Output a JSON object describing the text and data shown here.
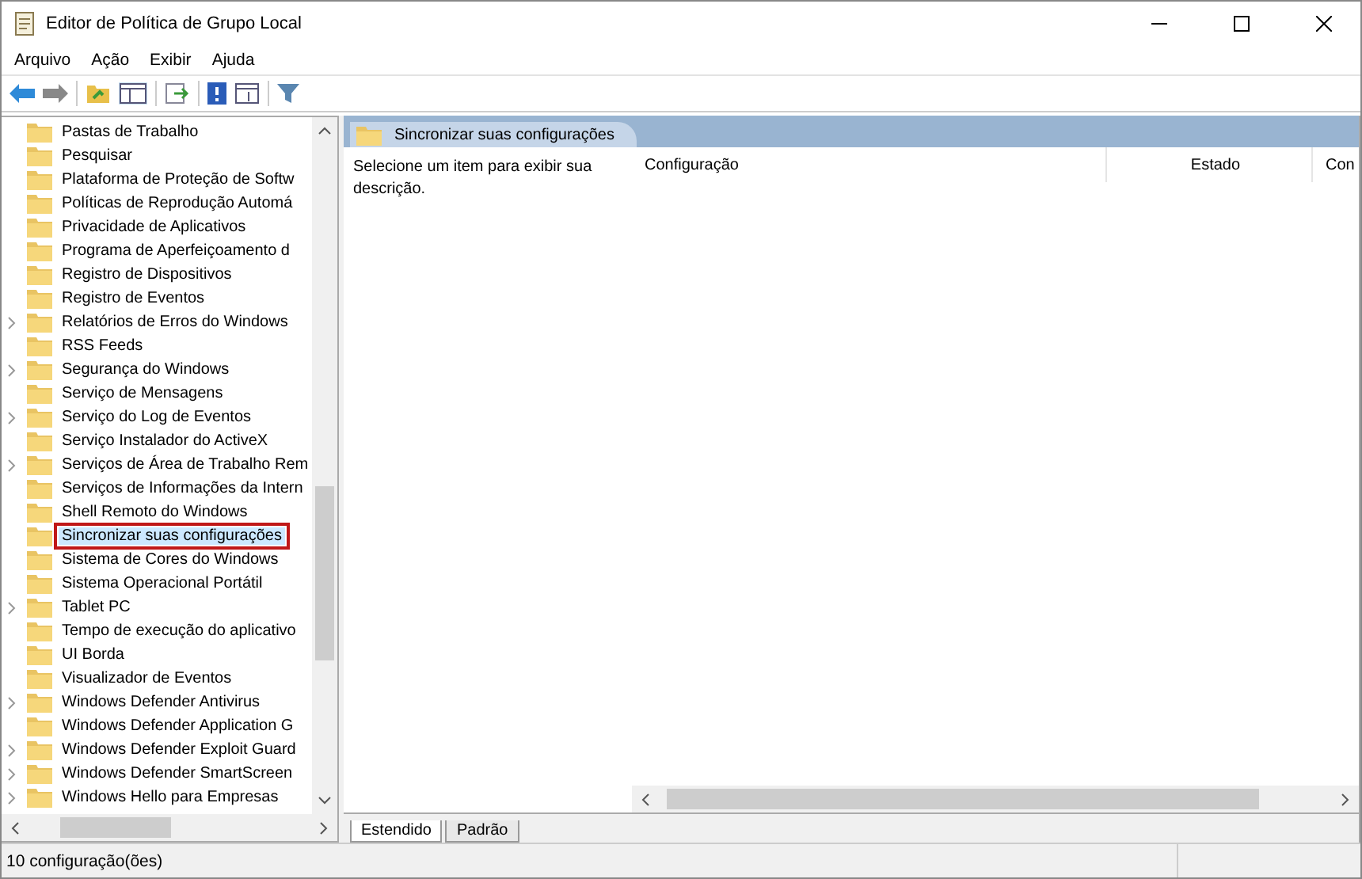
{
  "window": {
    "title": "Editor de Política de Grupo Local"
  },
  "menu": [
    "Arquivo",
    "Ação",
    "Exibir",
    "Ajuda"
  ],
  "tree": {
    "items": [
      {
        "label": "Pastas de Trabalho",
        "expandable": false,
        "selected": false
      },
      {
        "label": "Pesquisar",
        "expandable": false,
        "selected": false
      },
      {
        "label": "Plataforma de Proteção de Softw",
        "expandable": false,
        "selected": false
      },
      {
        "label": "Políticas de Reprodução Automá",
        "expandable": false,
        "selected": false
      },
      {
        "label": "Privacidade de Aplicativos",
        "expandable": false,
        "selected": false
      },
      {
        "label": "Programa de Aperfeiçoamento d",
        "expandable": false,
        "selected": false
      },
      {
        "label": "Registro de Dispositivos",
        "expandable": false,
        "selected": false
      },
      {
        "label": "Registro de Eventos",
        "expandable": false,
        "selected": false
      },
      {
        "label": "Relatórios de Erros do Windows",
        "expandable": true,
        "selected": false
      },
      {
        "label": "RSS Feeds",
        "expandable": false,
        "selected": false
      },
      {
        "label": "Segurança do Windows",
        "expandable": true,
        "selected": false
      },
      {
        "label": "Serviço de Mensagens",
        "expandable": false,
        "selected": false
      },
      {
        "label": "Serviço do Log de Eventos",
        "expandable": true,
        "selected": false
      },
      {
        "label": "Serviço Instalador do ActiveX",
        "expandable": false,
        "selected": false
      },
      {
        "label": "Serviços de Área de Trabalho Rem",
        "expandable": true,
        "selected": false
      },
      {
        "label": "Serviços de Informações da Intern",
        "expandable": false,
        "selected": false
      },
      {
        "label": "Shell Remoto do Windows",
        "expandable": false,
        "selected": false
      },
      {
        "label": "Sincronizar suas configurações",
        "expandable": false,
        "selected": true
      },
      {
        "label": "Sistema de Cores do Windows",
        "expandable": false,
        "selected": false
      },
      {
        "label": "Sistema Operacional Portátil",
        "expandable": false,
        "selected": false
      },
      {
        "label": "Tablet PC",
        "expandable": true,
        "selected": false
      },
      {
        "label": "Tempo de execução do aplicativo",
        "expandable": false,
        "selected": false
      },
      {
        "label": "UI Borda",
        "expandable": false,
        "selected": false
      },
      {
        "label": "Visualizador de Eventos",
        "expandable": false,
        "selected": false
      },
      {
        "label": "Windows Defender Antivirus",
        "expandable": true,
        "selected": false
      },
      {
        "label": "Windows Defender Application G",
        "expandable": false,
        "selected": false
      },
      {
        "label": "Windows Defender Exploit Guard",
        "expandable": true,
        "selected": false
      },
      {
        "label": "Windows Defender SmartScreen",
        "expandable": true,
        "selected": false
      },
      {
        "label": "Windows Hello para Empresas",
        "expandable": true,
        "selected": false
      }
    ]
  },
  "details": {
    "header": "Sincronizar suas configurações",
    "description": "Selecione um item para exibir sua descrição.",
    "columns": [
      "Configuração",
      "Estado",
      "Con"
    ],
    "tabs": [
      {
        "label": "Estendido",
        "selected": true
      },
      {
        "label": "Padrão",
        "selected": false
      }
    ]
  },
  "status_bar": "10 configuração(ões)"
}
